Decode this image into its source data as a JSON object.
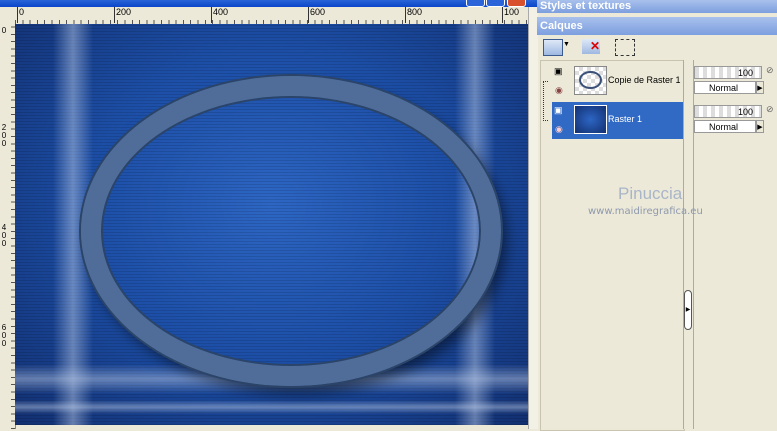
{
  "ruler": {
    "top_labels": [
      "0",
      "200",
      "400",
      "600",
      "800",
      "100"
    ],
    "left_labels": [
      "0",
      "200",
      "400",
      "600"
    ]
  },
  "panels": {
    "styles_title": "Styles et textures",
    "layers_title": "Calques"
  },
  "layers": [
    {
      "name": "Copie de Raster 1",
      "opacity": "100",
      "blend": "Normal",
      "selected": false
    },
    {
      "name": "Raster 1",
      "opacity": "100",
      "blend": "Normal",
      "selected": true
    }
  ],
  "watermark": {
    "name": "Pinuccia",
    "url": "www.maidiregrafica.eu"
  },
  "colors": {
    "selection": "#316ac5",
    "titlebar": "#0a46c8"
  }
}
